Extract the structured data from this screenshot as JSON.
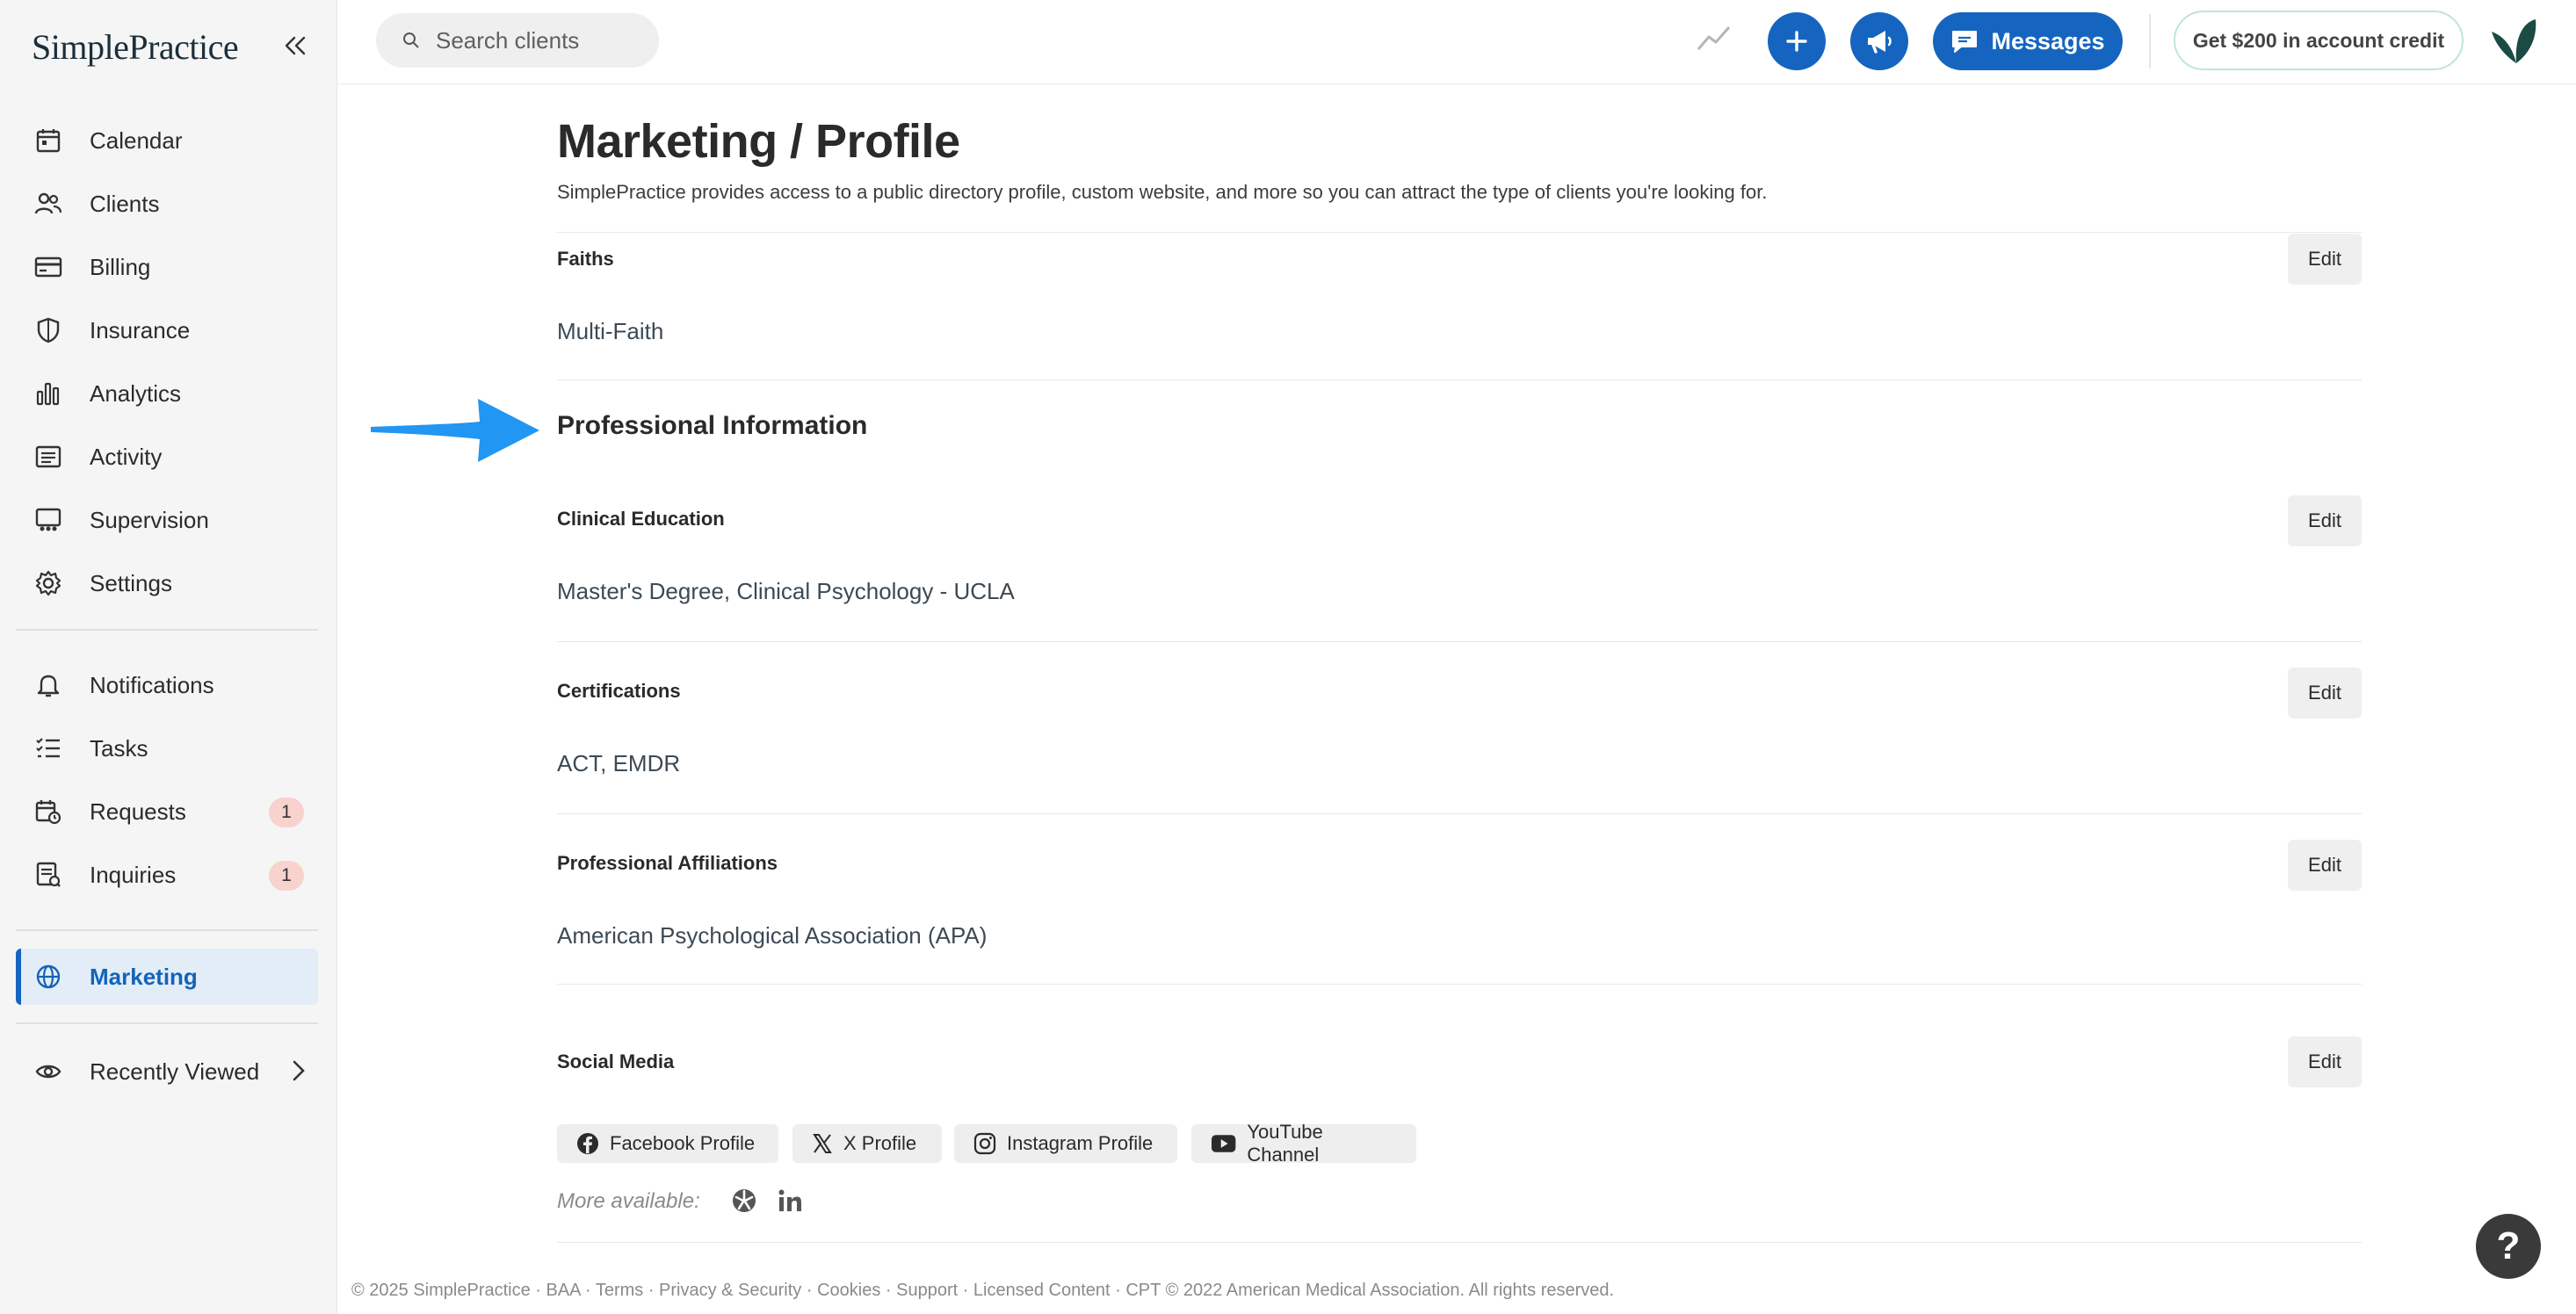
{
  "app": {
    "logo_text": "SimplePractice"
  },
  "sidebar": {
    "items": [
      {
        "label": "Calendar",
        "icon": "calendar-icon"
      },
      {
        "label": "Clients",
        "icon": "clients-icon"
      },
      {
        "label": "Billing",
        "icon": "billing-icon"
      },
      {
        "label": "Insurance",
        "icon": "shield-icon"
      },
      {
        "label": "Analytics",
        "icon": "bar-chart-icon"
      },
      {
        "label": "Activity",
        "icon": "activity-list-icon"
      },
      {
        "label": "Supervision",
        "icon": "supervision-icon"
      },
      {
        "label": "Settings",
        "icon": "gear-icon"
      }
    ],
    "secondary": [
      {
        "label": "Notifications",
        "icon": "bell-icon"
      },
      {
        "label": "Tasks",
        "icon": "tasks-icon"
      },
      {
        "label": "Requests",
        "icon": "calendar-clock-icon",
        "badge": "1"
      },
      {
        "label": "Inquiries",
        "icon": "inquiry-icon",
        "badge": "1"
      }
    ],
    "active": {
      "label": "Marketing",
      "icon": "globe-icon"
    },
    "recent": {
      "label": "Recently Viewed",
      "icon": "eye-icon"
    }
  },
  "topbar": {
    "search_placeholder": "Search clients",
    "messages_label": "Messages",
    "credit_label": "Get $200 in account credit"
  },
  "main": {
    "title": "Marketing / Profile",
    "subtitle": "SimplePractice provides access to a public directory profile, custom website, and more so you can attract the type of clients you're looking for.",
    "faiths": {
      "label": "Faiths",
      "value": "Multi-Faith",
      "edit": "Edit"
    },
    "professional_heading": "Professional Information",
    "clinical_education": {
      "label": "Clinical Education",
      "value": "Master's Degree, Clinical Psychology - UCLA",
      "edit": "Edit"
    },
    "certifications": {
      "label": "Certifications",
      "value": "ACT, EMDR",
      "edit": "Edit"
    },
    "affiliations": {
      "label": "Professional Affiliations",
      "value": "American Psychological Association (APA)",
      "edit": "Edit"
    },
    "social": {
      "label": "Social Media",
      "edit": "Edit",
      "chips": [
        "Facebook Profile",
        "X Profile",
        "Instagram Profile",
        "YouTube Channel"
      ],
      "more_label": "More available:"
    }
  },
  "footer": {
    "text": "© 2025 SimplePractice · BAA · Terms · Privacy & Security · Cookies · Support · Licensed Content · CPT © 2022 American Medical Association. All rights reserved."
  },
  "help": {
    "label": "?"
  },
  "colors": {
    "accent": "#1565c0",
    "active_bg": "#e3edf8",
    "badge_bg": "#f8d2cc",
    "arrow": "#2196f3"
  }
}
